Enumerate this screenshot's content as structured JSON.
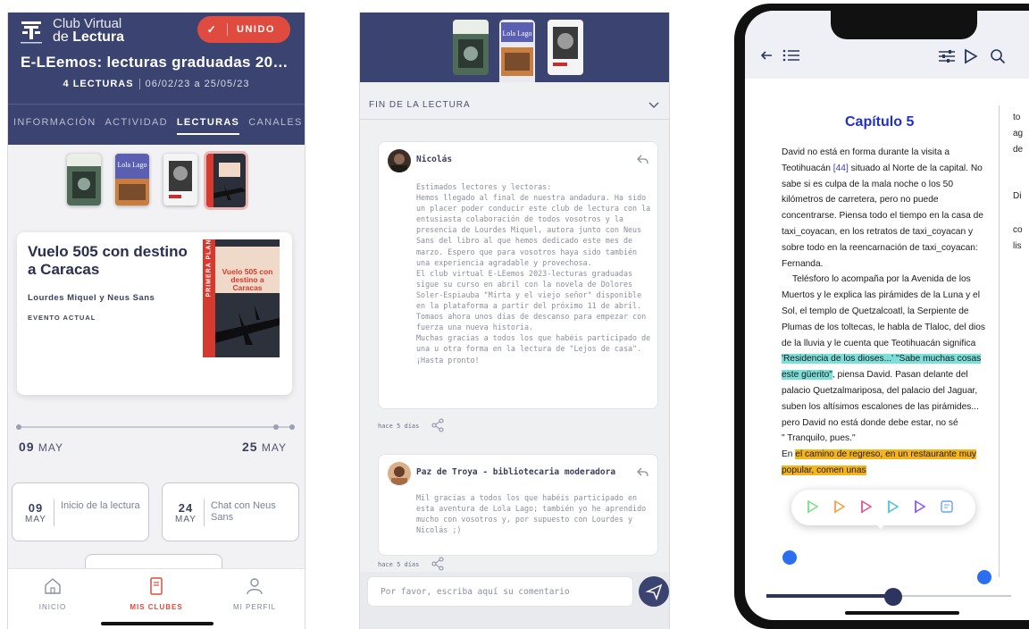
{
  "screen1": {
    "brand_line1": "Club Virtual",
    "brand_line2_prefix": "de ",
    "brand_line2_bold": "Lectura",
    "join_button": "UNIDO",
    "club_title": "E-LEemos: lecturas graduadas 20…",
    "readings_count": "4 LECTURAS",
    "date_range": "06/02/23 a 25/05/23",
    "tabs": [
      "INFORMACIÓN",
      "ACTIVIDAD",
      "LECTURAS",
      "CANALES"
    ],
    "active_tab": "LECTURAS",
    "book_title": "Vuelo 505 con destino a Caracas",
    "book_authors": "Lourdes Miquel y Neus Sans",
    "event_label": "EVENTO ACTUAL",
    "cover_series": "PRIMERA PLANA",
    "cover_title": "Vuelo 505 con destino a Caracas",
    "timeline_start_day": "09",
    "timeline_start_month": "MAY",
    "timeline_end_day": "25",
    "timeline_end_month": "MAY",
    "events": [
      {
        "day": "09",
        "month": "MAY",
        "label": "Inicio de la lectura"
      },
      {
        "day": "24",
        "month": "MAY",
        "label": "Chat con Neus Sans"
      }
    ],
    "bottom_nav": [
      {
        "label": "INICIO",
        "icon": "home-icon"
      },
      {
        "label": "MIS CLUBES",
        "icon": "book-icon"
      },
      {
        "label": "MI PERFIL",
        "icon": "user-icon"
      }
    ],
    "colors": {
      "header": "#3b4470",
      "accent": "#e04b3f"
    }
  },
  "screen2": {
    "section_title": "FIN DE LA LECTURA",
    "comment_placeholder": "Por favor, escriba aquí su comentario",
    "posts": [
      {
        "author": "Nicolás",
        "time": "hace 5 días",
        "paragraphs": [
          "Estimados lectores y lectoras:",
          "Hemos llegado al final de nuestra andadura. Ha sido un placer poder conducir este club de lectura con la entusiasta colaboración de todos vosotros y la presencia de Lourdes Miquel, autora junto con Neus Sans del libro al que hemos dedicado este mes de marzo. Espero que para vosotros haya sido también una experiencia agradable y provechosa.",
          "El club virtual E-LEemos 2023-lecturas graduadas sigue su curso en abril con la novela de Dolores Soler-Espiauba \"Mirta y el viejo señor\" disponible en la plataforma a partir del próximo 11 de abril.",
          "Tomaos ahora unos días de descanso para empezar con fuerza una nueva historia.",
          "Muchas gracias a todos los que habéis participado de una u otra forma en la lectura de \"Lejos de casa\". ¡Hasta pronto!"
        ]
      },
      {
        "author": "Paz de Troya - bibliotecaria moderadora",
        "time": "hace 5 días",
        "paragraphs": [
          "Mil gracias a todos los que habéis participado en esta aventura de Lola Lago; también yo he aprendido mucho con vosotros y, por supuesto con Lourdes y Nicolás ;)"
        ]
      }
    ]
  },
  "screen3": {
    "chapter_title": "Capítulo 5",
    "para1_a": "David no está en forma durante la visita a Teotihuacán ",
    "para1_ref": "[44]",
    "para1_b": " situado al Norte de la capital. No sabe si es culpa de la mala noche o los 50 kilómetros de carretera, pero no puede concentrarse. Piensa todo el tiempo en la casa de taxi_coyacan, en los retratos de taxi_coyacan y sobre todo en la reencarnación de taxi_coyacan: Fernanda.",
    "para2_a": "Telésforo lo acompaña por la Avenida de los Muertos y le explica las pirámides de la Luna y el Sol, el templo de Quetzalcoatl, la Serpiente de Plumas de los toltecas, le habla de Tlaloc, del dios de la lluvia y le cuenta que Teotihuacán significa ",
    "para2_hl1": "'Residencia de los dioses...' \"Sabe muchas cosas este güerito\"",
    "para2_b": ", piensa David. Pasan delante del palacio Quetzalmariposa, del palacio del Jaguar, suben los altísimos escalones de las pirámides... pero David no está donde debe estar, no sé",
    "para3_a": "\" Tranquilo, pues.\"",
    "para4_a": "En ",
    "para4_hl2": "el camino de regreso, en un restaurante muy popular, comen unas",
    "next_column": [
      "to",
      "ag",
      "de",
      "Di",
      "co",
      "lis"
    ],
    "highlight_colors": [
      "#7ddfd9",
      "#f4b41a"
    ],
    "pen_colors": [
      "#7ee08a",
      "#f3a24a",
      "#e0569a",
      "#4fc3e0",
      "#8b5cf6",
      "#6aa0ff"
    ]
  }
}
